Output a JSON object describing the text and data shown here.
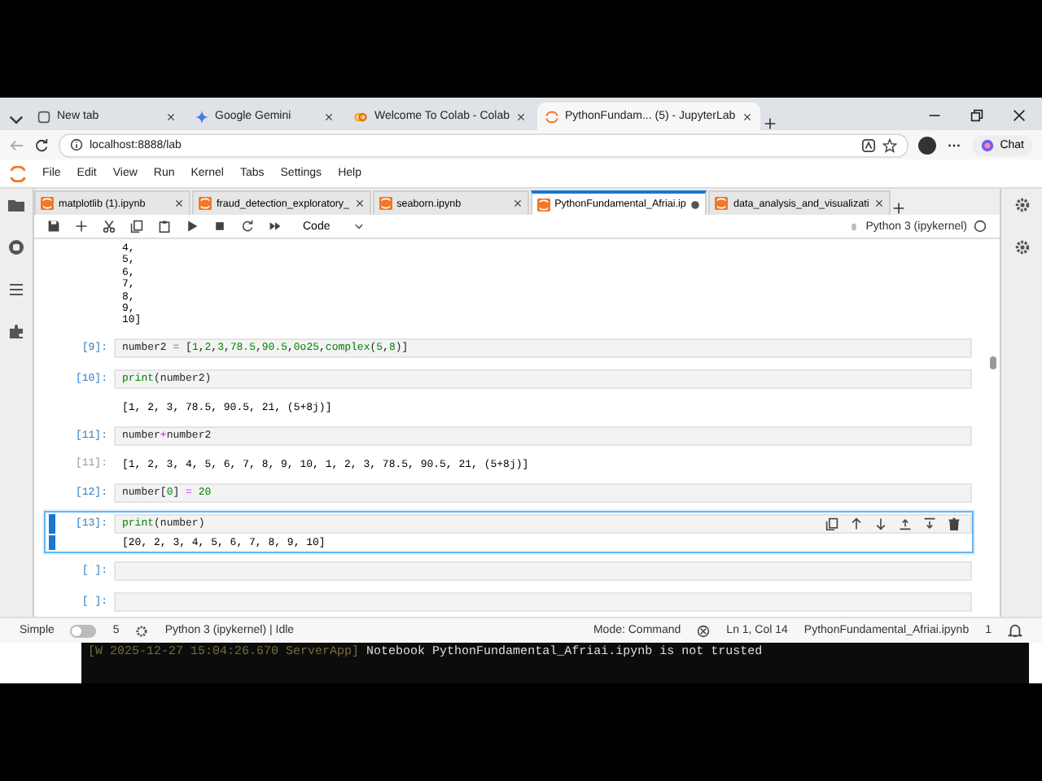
{
  "browser_tabs": [
    {
      "title": "New tab",
      "selected": false
    },
    {
      "title": "Google Gemini",
      "selected": false
    },
    {
      "title": "Welcome To Colab - Colab",
      "selected": false
    },
    {
      "title": "PythonFundam... (5) - JupyterLab",
      "selected": true
    }
  ],
  "address": "localhost:8888/lab",
  "chat_button": "Chat",
  "menu": [
    "File",
    "Edit",
    "View",
    "Run",
    "Kernel",
    "Tabs",
    "Settings",
    "Help"
  ],
  "notebook_tabs": [
    {
      "title": "matplotlib (1).ipynb",
      "selected": false,
      "dirty": false
    },
    {
      "title": "fraud_detection_exploratory_",
      "selected": false,
      "dirty": false
    },
    {
      "title": "seaborn.ipynb",
      "selected": false,
      "dirty": false
    },
    {
      "title": "PythonFundamental_Afriai.ip",
      "selected": true,
      "dirty": true
    },
    {
      "title": "data_analysis_and_visualizati",
      "selected": false,
      "dirty": false
    }
  ],
  "toolbar": {
    "cell_type": "Code",
    "kernel": "Python 3 (ipykernel)"
  },
  "cells": [
    {
      "kind": "output",
      "lines": [
        "4,",
        "5,",
        "6,",
        "7,",
        "8,",
        "9,",
        "10]"
      ],
      "selected": false
    },
    {
      "kind": "code",
      "prompt": "[9]:",
      "selected": false,
      "code": [
        {
          "t": "number2 ",
          "kind": "plain"
        },
        {
          "t": "=",
          "kind": "op"
        },
        {
          "t": " [",
          "kind": "plain"
        },
        {
          "t": "1",
          "kind": "num"
        },
        {
          "t": ",",
          "kind": "plain"
        },
        {
          "t": "2",
          "kind": "num"
        },
        {
          "t": ",",
          "kind": "plain"
        },
        {
          "t": "3",
          "kind": "num"
        },
        {
          "t": ",",
          "kind": "plain"
        },
        {
          "t": "78.5",
          "kind": "num"
        },
        {
          "t": ",",
          "kind": "plain"
        },
        {
          "t": "90.5",
          "kind": "num"
        },
        {
          "t": ",",
          "kind": "plain"
        },
        {
          "t": "0o25",
          "kind": "num"
        },
        {
          "t": ",",
          "kind": "plain"
        },
        {
          "t": "complex",
          "kind": "builtin"
        },
        {
          "t": "(",
          "kind": "plain"
        },
        {
          "t": "5",
          "kind": "num"
        },
        {
          "t": ",",
          "kind": "plain"
        },
        {
          "t": "8",
          "kind": "num"
        },
        {
          "t": ")]",
          "kind": "plain"
        }
      ]
    },
    {
      "kind": "code",
      "prompt": "[10]:",
      "selected": false,
      "code": [
        {
          "t": "print",
          "kind": "builtin"
        },
        {
          "t": "(number2)",
          "kind": "plain"
        }
      ]
    },
    {
      "kind": "output",
      "lines": [
        "[1, 2, 3, 78.5, 90.5, 21, (5+8j)]"
      ],
      "selected": false
    },
    {
      "kind": "code",
      "prompt": "[11]:",
      "selected": false,
      "code": [
        {
          "t": "number",
          "kind": "plain"
        },
        {
          "t": "+",
          "kind": "op"
        },
        {
          "t": "number2",
          "kind": "plain"
        }
      ]
    },
    {
      "kind": "output",
      "prompt": "[11]:",
      "lines": [
        "[1, 2, 3, 4, 5, 6, 7, 8, 9, 10, 1, 2, 3, 78.5, 90.5, 21, (5+8j)]"
      ],
      "selected": false
    },
    {
      "kind": "code",
      "prompt": "[12]:",
      "selected": false,
      "code": [
        {
          "t": "number[",
          "kind": "plain"
        },
        {
          "t": "0",
          "kind": "num"
        },
        {
          "t": "] ",
          "kind": "plain"
        },
        {
          "t": "= ",
          "kind": "op"
        },
        {
          "t": "20",
          "kind": "num"
        }
      ]
    },
    {
      "kind": "code",
      "prompt": "[13]:",
      "selected": true,
      "code": [
        {
          "t": "print",
          "kind": "builtin"
        },
        {
          "t": "(number)",
          "kind": "plain"
        }
      ],
      "output": "[20, 2, 3, 4, 5, 6, 7, 8, 9, 10]"
    },
    {
      "kind": "code",
      "prompt": "[ ]:",
      "selected": false
    },
    {
      "kind": "code",
      "prompt": "[ ]:",
      "selected": false
    }
  ],
  "status_bar": {
    "mode_label": "Simple",
    "simple_on": false,
    "count": "5",
    "kernel_status": "Python 3 (ipykernel) | Idle",
    "mode": "Mode: Command",
    "position": "Ln 1, Col 14",
    "file": "PythonFundamental_Afriai.ipynb",
    "notifications": "1"
  },
  "terminal": {
    "prefix": "[W 2025-12-27 15:04:26.670 ServerApp]",
    "message": "Notebook PythonFundamental_Afriai.ipynb is not trusted"
  }
}
